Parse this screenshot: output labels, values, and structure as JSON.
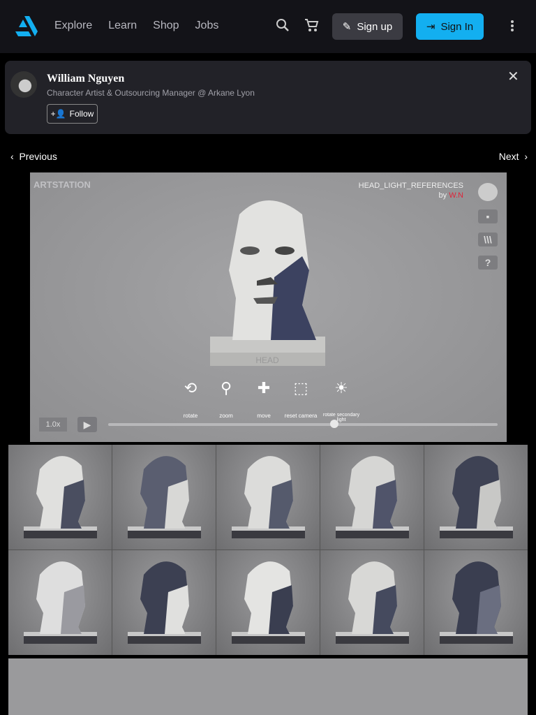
{
  "header": {
    "nav": [
      "Explore",
      "Learn",
      "Shop",
      "Jobs"
    ],
    "signup": "Sign up",
    "signin": "Sign In",
    "accent": "#13aff0"
  },
  "artist": {
    "name": "William Nguyen",
    "role": "Character Artist & Outsourcing Manager @ Arkane Lyon",
    "follow": "Follow"
  },
  "pager": {
    "previous": "Previous",
    "next": "Next"
  },
  "viewer": {
    "watermark": "ARTSTATION",
    "title": "HEAD_LIGHT_REFERENCES",
    "by": "by",
    "author": "W.N",
    "base_label": "HEAD",
    "help": "?",
    "speed": "1.0x",
    "progress": 0.58,
    "controls": [
      {
        "label": "rotate",
        "icon": "⟲"
      },
      {
        "label": "zoom",
        "icon": "⚲"
      },
      {
        "label": "move",
        "icon": "✚"
      },
      {
        "label": "reset camera",
        "icon": "⬚"
      },
      {
        "label": "rotate secondary light",
        "icon": "☀"
      }
    ]
  },
  "gallery": {
    "count": 10
  }
}
